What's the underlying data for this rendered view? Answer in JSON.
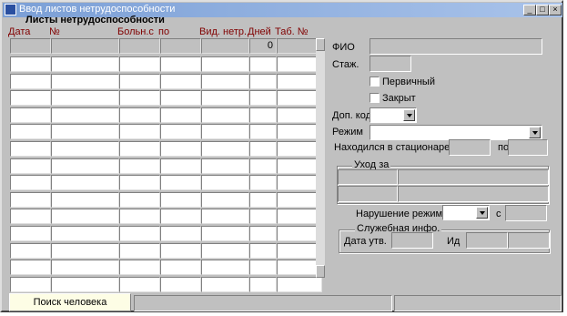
{
  "window": {
    "title": "Ввод листов нетрудоспособности",
    "minimize_glyph": "_",
    "maximize_glyph": "□",
    "close_glyph": "×"
  },
  "grid": {
    "title": "Листы нетрудоспособности",
    "headers": {
      "date": "Дата",
      "number": "№",
      "sick_from": "Больн.с",
      "to": "по",
      "type": "Вид. нетр.",
      "days": "Дней",
      "tab": "Таб. №"
    },
    "days_total": "0",
    "row_count": 14
  },
  "form": {
    "fio_label": "ФИО",
    "fio_value": "",
    "stazh_label": "Стаж.",
    "primary_label": "Первичный",
    "closed_label": "Закрыт",
    "dop_kod_label": "Доп. код",
    "rezhim_label": "Режим",
    "hospital_label": "Находился в стационаре с",
    "hospital_to_label": "по",
    "care_label": "Уход за",
    "violation_label": "Нарушение режима",
    "violation_from_label": "с",
    "service_label": "Служебная инфо.",
    "date_label": "Дата утв.",
    "id_label": "Ид"
  },
  "bottom": {
    "search_button": "Поиск человека"
  },
  "colors": {
    "face": "#c0c0c0",
    "header_red": "#800000",
    "title_gradient_start": "#7b9fd6"
  }
}
